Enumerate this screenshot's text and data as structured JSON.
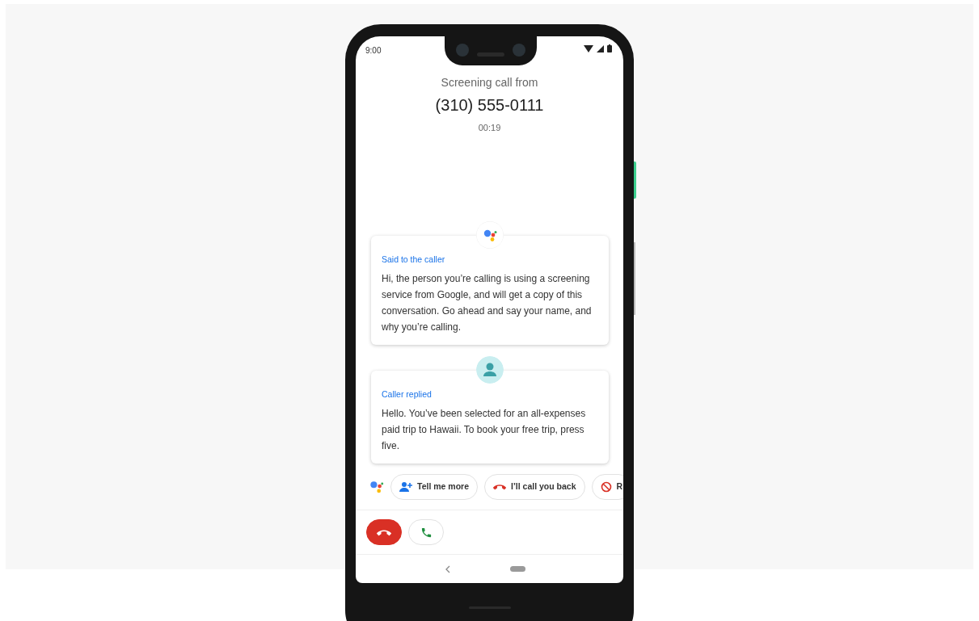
{
  "status_bar": {
    "time": "9:00"
  },
  "header": {
    "title": "Screening call from",
    "number": "(310) 555-0111",
    "duration": "00:19"
  },
  "messages": [
    {
      "kind": "assistant",
      "label": "Said to the caller",
      "text": "Hi, the person you’re calling is using a screening service from Google, and will get a copy of this conversation. Go ahead and say your name, and why you’re calling."
    },
    {
      "kind": "caller",
      "label": "Caller replied",
      "text": "Hello. You’ve been selected for an all-expenses paid trip to Hawaii. To book your free trip, press five."
    }
  ],
  "suggestions": [
    {
      "kind": "more",
      "label": "Tell me more"
    },
    {
      "kind": "callback",
      "label": "I’ll call you back"
    },
    {
      "kind": "report",
      "label": "R"
    }
  ]
}
